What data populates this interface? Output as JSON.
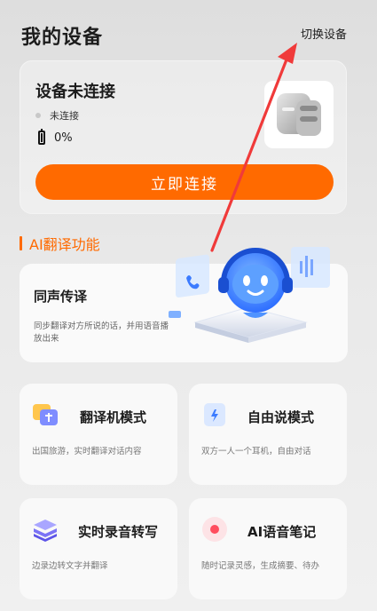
{
  "header": {
    "title": "我的设备",
    "switch_label": "切换设备"
  },
  "device": {
    "status": "设备未连接",
    "connection": "未连接",
    "battery": "0%",
    "connect_button": "立即连接"
  },
  "section": {
    "title": "AI翻译功能"
  },
  "simultaneous": {
    "title": "同声传译",
    "desc": "同步翻译对方所说的话，并用语音播放出来"
  },
  "features": [
    {
      "title": "翻译机模式",
      "desc": "出国旅游，实时翻译对话内容"
    },
    {
      "title": "自由说模式",
      "desc": "双方一人一个耳机，自由对话"
    },
    {
      "title": "实时录音转写",
      "desc": "边录边转文字并翻译"
    },
    {
      "title": "AI语音笔记",
      "desc": "随时记录灵感，生成摘要、待办"
    }
  ],
  "colors": {
    "accent": "#ff6a00",
    "annotation_arrow": "#f03a3a"
  }
}
